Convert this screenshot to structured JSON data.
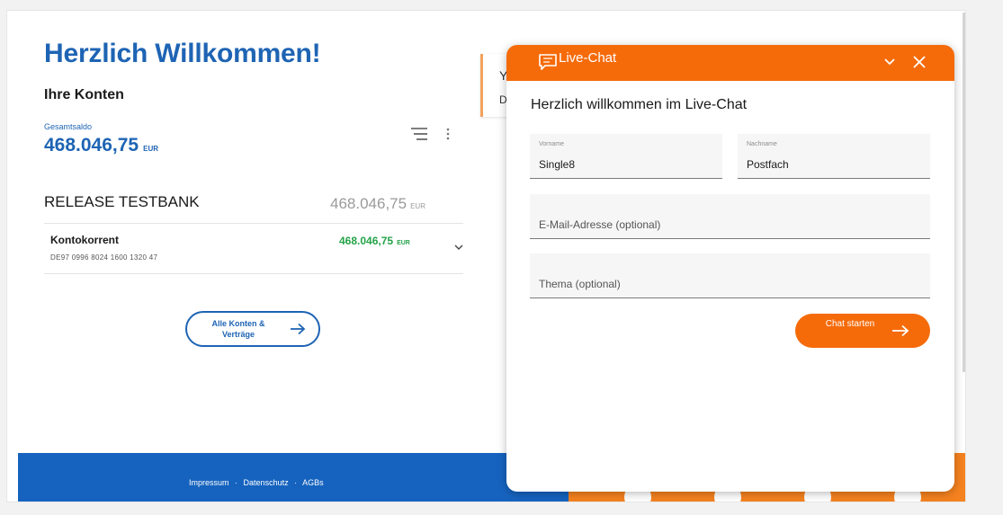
{
  "dashboard": {
    "headline": "Herzlich Willkommen!",
    "subhead": "Ihre Konten",
    "saldo_label": "Gesamtsaldo",
    "saldo_value": "468.046,75",
    "saldo_currency": "EUR",
    "bank": {
      "name": "RELEASE TESTBANK",
      "total": "468.046,75",
      "currency": "EUR"
    },
    "account": {
      "name": "Kontokorrent",
      "iban": "DE97 0996 8024 1600 1320 47",
      "amount": "468.046,75",
      "currency": "EUR"
    },
    "all_accounts_button": "Alle Konten & Verträge"
  },
  "bg_card": {
    "line1": "Y",
    "line2": "D"
  },
  "footer": {
    "links": [
      "Impressum",
      "Datenschutz",
      "AGBs"
    ],
    "separator": "·"
  },
  "chat": {
    "title": "Live-Chat",
    "welcome": "Herzlich willkommen im Live-Chat",
    "first_name_label": "Vorname",
    "first_name_value": "Single8",
    "last_name_label": "Nachname",
    "last_name_value": "Postfach",
    "email_placeholder": "E-Mail-Adresse (optional)",
    "topic_placeholder": "Thema (optional)",
    "start_button": "Chat starten"
  },
  "colors": {
    "brand_blue": "#1e64b4",
    "chat_orange": "#f56b0a",
    "positive_green": "#24a348",
    "footer_blue": "#1663bf",
    "footer_orange": "#f5821f"
  }
}
